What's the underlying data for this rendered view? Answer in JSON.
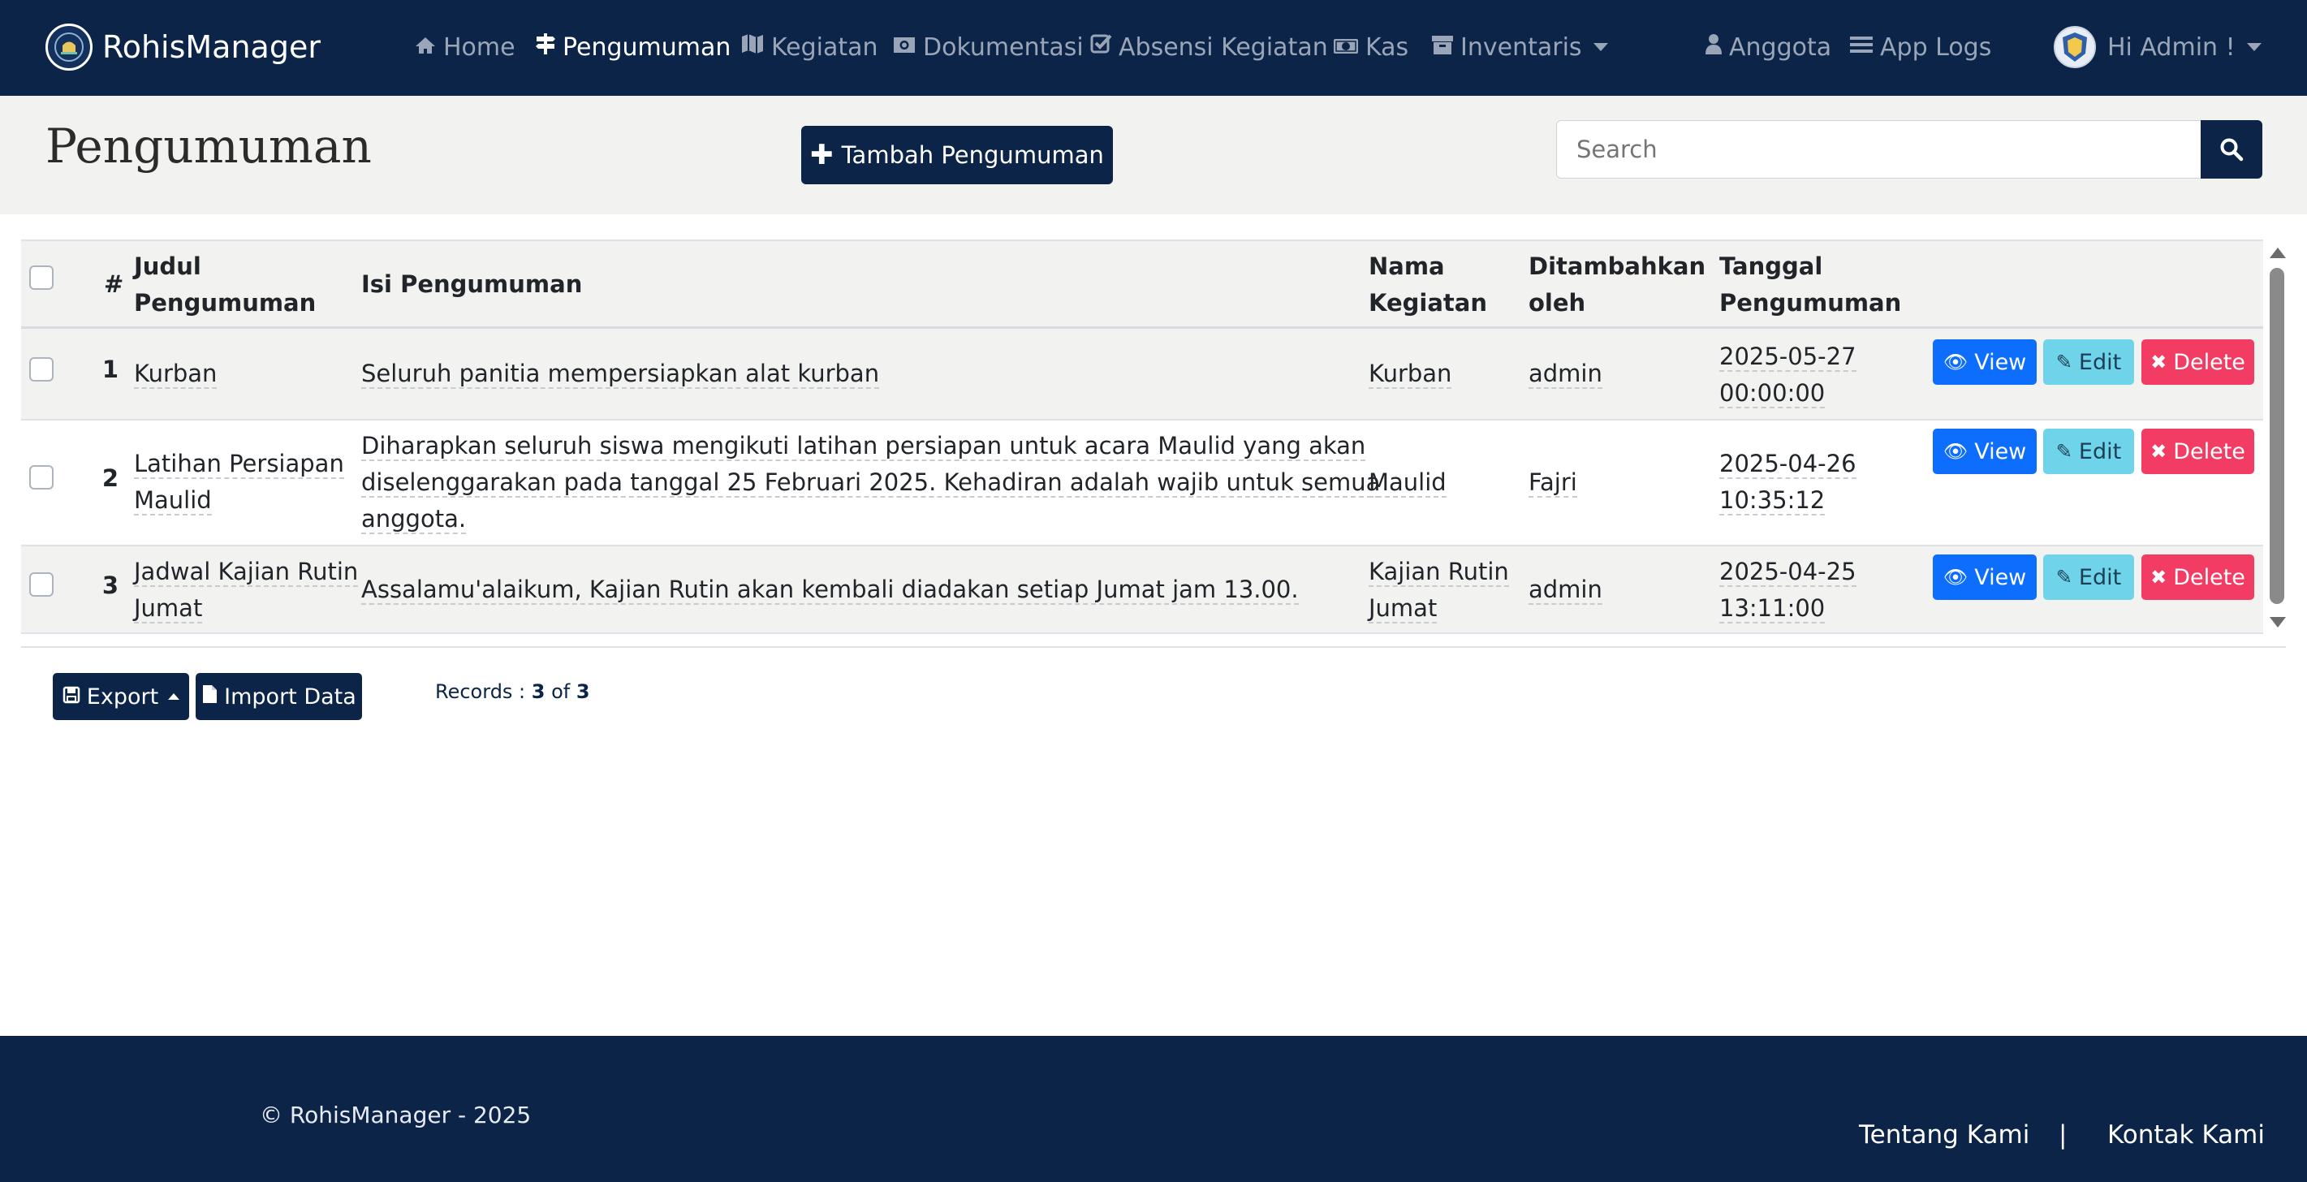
{
  "navbar": {
    "brand": "RohisManager",
    "items": [
      {
        "label": "Home",
        "icon": "home-icon"
      },
      {
        "label": "Pengumuman",
        "icon": "signpost-icon",
        "active": true
      },
      {
        "label": "Kegiatan",
        "icon": "map-icon"
      },
      {
        "label": "Dokumentasi",
        "icon": "camera-icon"
      },
      {
        "label": "Absensi Kegiatan",
        "icon": "check-square-icon"
      },
      {
        "label": "Kas",
        "icon": "money-icon"
      },
      {
        "label": "Inventaris",
        "icon": "archive-icon"
      },
      {
        "label": "Anggota",
        "icon": "user-icon"
      },
      {
        "label": "App Logs",
        "icon": "list-icon"
      }
    ],
    "user_greeting": "Hi Admin !"
  },
  "page": {
    "title": "Pengumuman",
    "add_button": "Tambah Pengumuman",
    "search_placeholder": "Search"
  },
  "table": {
    "headers": {
      "num": "#",
      "judul_1": "Judul",
      "judul_2": "Pengumuman",
      "isi": "Isi Pengumuman",
      "nama_1": "Nama",
      "nama_2": "Kegiatan",
      "oleh_1": "Ditambahkan",
      "oleh_2": "oleh",
      "tgl_1": "Tanggal",
      "tgl_2": "Pengumuman"
    },
    "rows": [
      {
        "num": "1",
        "judul": [
          "Kurban"
        ],
        "isi": [
          "Seluruh panitia mempersiapkan alat kurban"
        ],
        "nama": [
          "Kurban"
        ],
        "oleh": "admin",
        "tanggal": [
          "2025-05-27",
          "00:00:00"
        ]
      },
      {
        "num": "2",
        "judul": [
          "Latihan Persiapan",
          "Maulid"
        ],
        "isi": [
          "Diharapkan seluruh siswa mengikuti latihan persiapan untuk acara Maulid yang akan",
          "diselenggarakan pada tanggal 25 Februari 2025. Kehadiran adalah wajib untuk semua",
          "anggota."
        ],
        "nama": [
          "Maulid"
        ],
        "oleh": "Fajri",
        "tanggal": [
          "2025-04-26",
          "10:35:12"
        ]
      },
      {
        "num": "3",
        "judul": [
          "Jadwal Kajian Rutin",
          "Jumat"
        ],
        "isi": [
          "Assalamu'alaikum, Kajian Rutin akan kembali diadakan setiap Jumat jam 13.00."
        ],
        "nama": [
          "Kajian Rutin",
          "Jumat"
        ],
        "oleh": "admin",
        "tanggal": [
          "2025-04-25",
          "13:11:00"
        ]
      }
    ],
    "actions": {
      "view": "View",
      "edit": "Edit",
      "delete": "Delete"
    }
  },
  "bottom": {
    "export": "Export",
    "import": "Import Data",
    "records_label": "Records : ",
    "records_shown": "3",
    "records_of": " of ",
    "records_total": "3"
  },
  "footer": {
    "copyright": "© RohisManager - 2025",
    "about": "Tentang Kami",
    "separator": "|",
    "contact": "Kontak Kami"
  },
  "colors": {
    "navbar": "#0b2447",
    "view": "#0d6efd",
    "edit": "#6fd3ea",
    "delete": "#f23c63"
  }
}
